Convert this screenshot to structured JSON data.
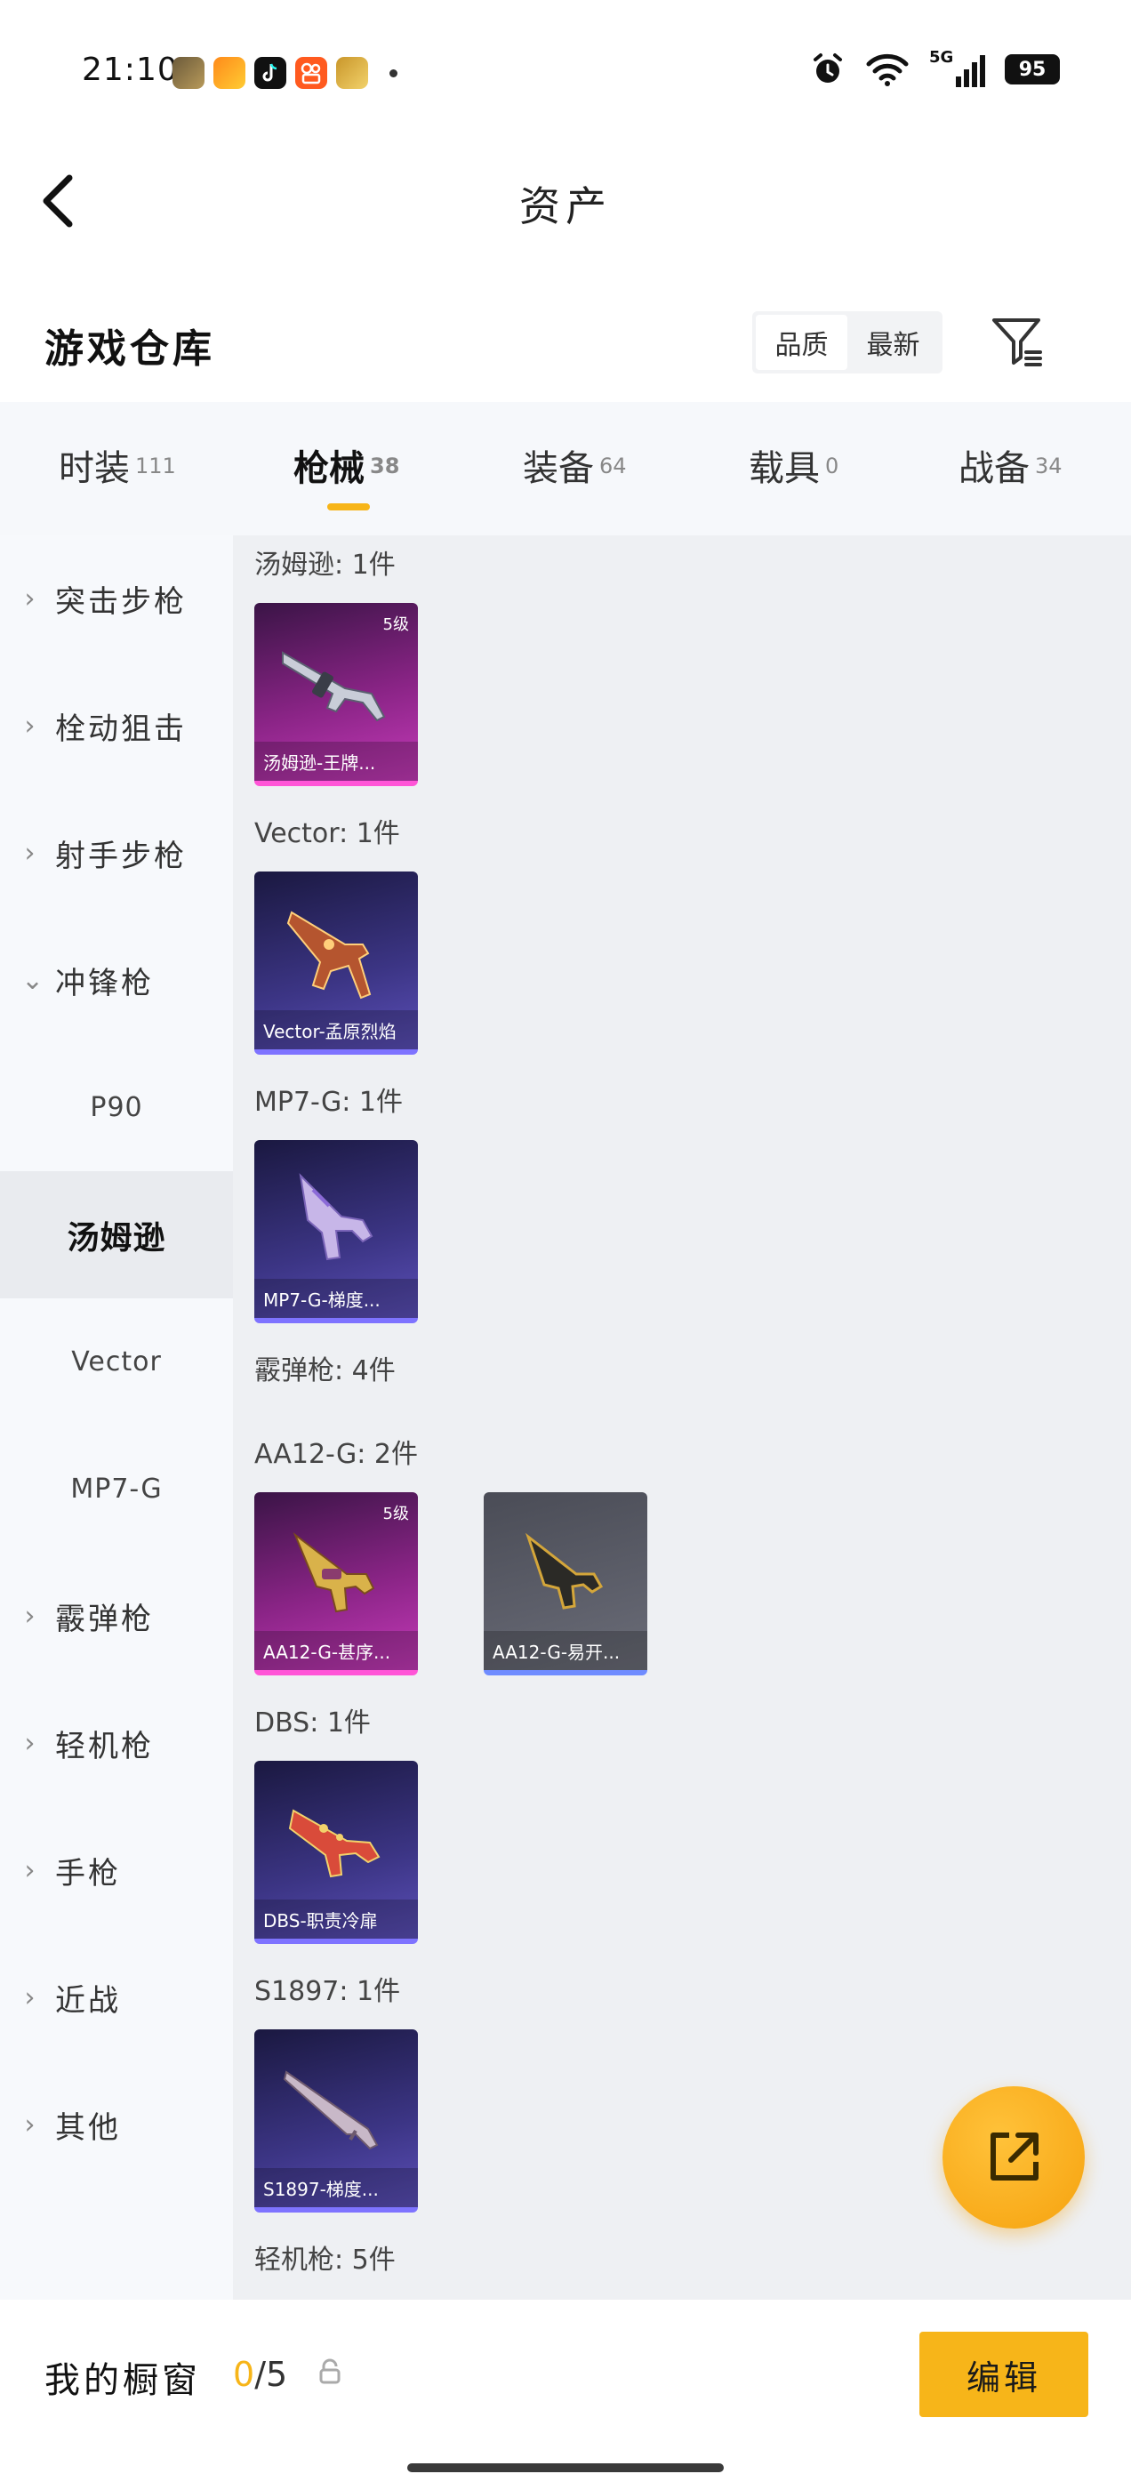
{
  "status_bar": {
    "time": "21:10",
    "battery": "95",
    "network": "5G",
    "icons": [
      "pubg-app-icon",
      "taobao-app-icon",
      "tiktok-app-icon",
      "kuaishou-app-icon",
      "game-app-icon"
    ]
  },
  "header": {
    "title": "资产",
    "back_icon": "chevron-left-icon"
  },
  "warehouse": {
    "title": "游戏仓库",
    "sort_options": [
      "品质",
      "最新"
    ],
    "sort_selected": "品质",
    "filter_icon": "filter-icon"
  },
  "tabs": [
    {
      "label": "时装",
      "count": "111"
    },
    {
      "label": "枪械",
      "count": "38",
      "active": true
    },
    {
      "label": "装备",
      "count": "64"
    },
    {
      "label": "载具",
      "count": "0"
    },
    {
      "label": "战备",
      "count": "34"
    }
  ],
  "sidebar": {
    "items": [
      {
        "label": "突击步枪",
        "chev": ">"
      },
      {
        "label": "栓动狙击",
        "chev": ">"
      },
      {
        "label": "射手步枪",
        "chev": ">"
      },
      {
        "label": "冲锋枪",
        "chev": "v"
      },
      {
        "label": "P90"
      },
      {
        "label": "汤姆逊"
      },
      {
        "label": "Vector"
      },
      {
        "label": "MP7-G"
      },
      {
        "label": "霰弹枪",
        "chev": ">"
      },
      {
        "label": "轻机枪",
        "chev": ">"
      },
      {
        "label": "手枪",
        "chev": ">"
      },
      {
        "label": "近战",
        "chev": ">"
      },
      {
        "label": "其他",
        "chev": ">"
      }
    ],
    "selected": "汤姆逊"
  },
  "content": {
    "groups": [
      {
        "label": "汤姆逊: 1件",
        "cards": [
          {
            "caption": "汤姆逊-王牌...",
            "level": "5级",
            "rarity": "pink"
          }
        ]
      },
      {
        "label": "Vector: 1件",
        "cards": [
          {
            "caption": "Vector-孟原烈焰",
            "rarity": "blue"
          }
        ]
      },
      {
        "label": "MP7-G: 1件",
        "cards": [
          {
            "caption": "MP7-G-梯度...",
            "rarity": "blue"
          }
        ]
      },
      {
        "label": "霰弹枪: 4件"
      },
      {
        "label": "AA12-G: 2件",
        "cards": [
          {
            "caption": "AA12-G-甚序...",
            "level": "5级",
            "rarity": "pink"
          },
          {
            "caption": "AA12-G-易开...",
            "rarity": "grey"
          }
        ]
      },
      {
        "label": "DBS: 1件",
        "cards": [
          {
            "caption": "DBS-职责冷扉",
            "rarity": "blue"
          }
        ]
      },
      {
        "label": "S1897: 1件",
        "cards": [
          {
            "caption": "S1897-梯度...",
            "rarity": "blue"
          }
        ]
      },
      {
        "label": "轻机枪: 5件"
      }
    ]
  },
  "fab": {
    "icon": "share-external-icon"
  },
  "bottom_bar": {
    "showcase_label": "我的橱窗",
    "showcase_current": "0",
    "showcase_total": "/5",
    "edit_label": "编辑",
    "lock_icon": "lock-icon"
  },
  "colors": {
    "accent": "#f7b519",
    "rarity_pink": "#ff55d7",
    "rarity_blue": "#7e73ff"
  }
}
